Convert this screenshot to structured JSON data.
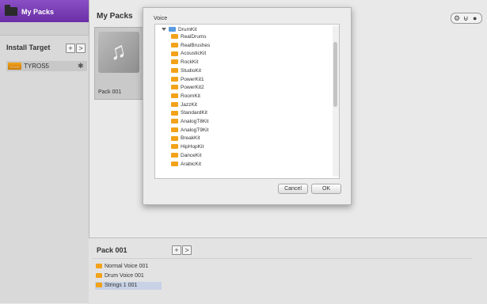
{
  "sidebar": {
    "header_label": "My Packs",
    "install_target_label": "Install Target",
    "add_label": "+",
    "nav_label": ">",
    "device_label": "TYROS5"
  },
  "main": {
    "title": "My Packs",
    "top_right_icons": [
      "gear-icon",
      "cart-icon",
      "info-icon"
    ]
  },
  "pack_tile": {
    "caption": "Pack 001",
    "icon": "music-note-icon"
  },
  "dialog": {
    "title": "Voice",
    "root": "DrumKit",
    "items": [
      "RealDrums",
      "RealBrushes",
      "AcousticKit",
      "RockKit",
      "StudioKit",
      "PowerKit1",
      "PowerKit2",
      "RoomKit",
      "JazzKit",
      "StandardKit",
      "AnalogT8Kit",
      "AnalogT9Kit",
      "BreakKit",
      "HipHopKit",
      "DanceKit",
      "ArabicKit"
    ],
    "cancel_label": "Cancel",
    "ok_label": "OK"
  },
  "bottom_panel": {
    "title": "Pack 001",
    "add_label": "+",
    "nav_label": ">",
    "items": [
      "Normal Voice 001",
      "Drum Voice 001",
      "Strings 1 001"
    ]
  },
  "colors": {
    "accent_purple": "#7a3db8",
    "folder_orange": "#f3a21a",
    "selection_blue": "#c7d2e6"
  }
}
